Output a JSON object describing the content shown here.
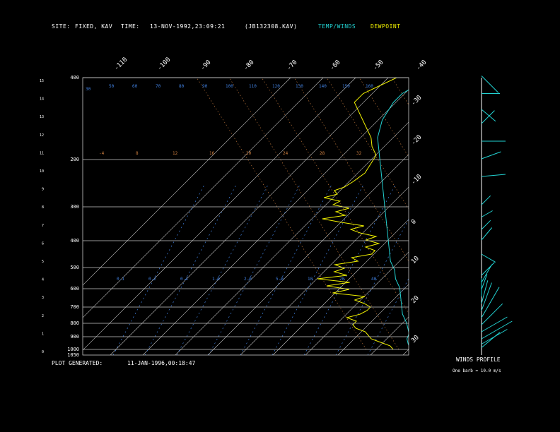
{
  "header": {
    "site_label": "SITE:",
    "site_value": "FIXED, KAV",
    "time_label": "TIME:",
    "time_value": "13-NOV-1992,23:09:21",
    "file": "(JB132308.KAV)",
    "legend_temp": "TEMP/WINDS",
    "legend_dew": "DEWPOINT"
  },
  "footer": {
    "generated_label": "PLOT GENERATED:",
    "generated_value": "11-JAN-1996,00:18:47",
    "winds_title": "WINDS PROFILE",
    "winds_note": "One barb = 10.0 m/s"
  },
  "colors": {
    "temperature": "#22d3d3",
    "dewpoint": "#f0f000",
    "isobar": "#c8c8c8",
    "isotherm": "#c8c8c8",
    "dry_adiabat": "#d08040",
    "mixing_ratio": "#4080e0",
    "moist_adiabat": "#d08040"
  },
  "chart_data": {
    "type": "line",
    "subtype": "skew-t log-p sounding",
    "pressure_ticks_mb": [
      "400",
      "200",
      "300",
      "400",
      "500",
      "600",
      "700",
      "800",
      "900",
      "1000",
      "1050"
    ],
    "isobars_mb": [
      400,
      200,
      300,
      400,
      500,
      600,
      700,
      800,
      900,
      1000
    ],
    "height_ticks_km": [
      "15",
      "14",
      "13",
      "12",
      "11",
      "10",
      "9",
      "8",
      "7",
      "6",
      "5",
      "4",
      "3",
      "2",
      "1",
      "0"
    ],
    "temp_top_ticks": [
      "-110",
      "-100",
      "-90",
      "-80",
      "-70",
      "-60",
      "-50",
      "-40"
    ],
    "temp_right_ticks": [
      "-30",
      "-20",
      "-10",
      "0",
      "10",
      "20",
      "30"
    ],
    "mixing_ratio_labels": [
      "0.1",
      "0.2",
      "0.4",
      "1.0",
      "2.0",
      "5.0",
      "10",
      "20",
      "40"
    ],
    "dry_adiabat_labels_row1": [
      "30",
      "50",
      "60",
      "70",
      "80",
      "90",
      "100",
      "110",
      "120",
      "130",
      "140",
      "150",
      "160"
    ],
    "dry_adiabat_labels_row2": [
      "-4",
      "8",
      "12",
      "16",
      "20",
      "24",
      "28",
      "32"
    ],
    "series": [
      {
        "name": "TEMP/WINDS",
        "points": [
          [
            0.0,
            -4.5
          ],
          [
            0.3,
            -7
          ],
          [
            0.6,
            -9
          ],
          [
            0.9,
            -10
          ],
          [
            1.2,
            -12
          ],
          [
            1.5,
            -14
          ],
          [
            2.0,
            -18
          ],
          [
            2.5,
            -21
          ],
          [
            3.0,
            -24
          ],
          [
            3.5,
            -27
          ],
          [
            4.0,
            -31
          ],
          [
            4.5,
            -34
          ],
          [
            5.0,
            -38
          ],
          [
            5.5,
            -41
          ],
          [
            6.0,
            -44
          ],
          [
            6.5,
            -47
          ],
          [
            7.0,
            -50
          ],
          [
            7.5,
            -53
          ],
          [
            8.0,
            -56
          ],
          [
            8.5,
            -59
          ],
          [
            9.0,
            -62
          ],
          [
            9.5,
            -65
          ],
          [
            10.0,
            -68
          ],
          [
            10.5,
            -71
          ],
          [
            11.0,
            -74
          ],
          [
            11.5,
            -77
          ],
          [
            12.0,
            -80
          ],
          [
            12.5,
            -82
          ],
          [
            13.0,
            -84
          ],
          [
            13.5,
            -85
          ],
          [
            14.0,
            -86
          ],
          [
            14.5,
            -86
          ],
          [
            15.0,
            -84
          ],
          [
            15.5,
            -83
          ]
        ]
      },
      {
        "name": "DEWPOINT",
        "points": [
          [
            0.0,
            -10
          ],
          [
            0.2,
            -12
          ],
          [
            0.4,
            -16
          ],
          [
            0.6,
            -20
          ],
          [
            0.8,
            -22
          ],
          [
            1.0,
            -24
          ],
          [
            1.2,
            -28
          ],
          [
            1.4,
            -30
          ],
          [
            1.6,
            -30
          ],
          [
            1.8,
            -34
          ],
          [
            2.0,
            -31
          ],
          [
            2.2,
            -30
          ],
          [
            2.4,
            -30
          ],
          [
            2.6,
            -33
          ],
          [
            2.8,
            -37
          ],
          [
            3.0,
            -35
          ],
          [
            3.2,
            -46
          ],
          [
            3.4,
            -42
          ],
          [
            3.6,
            -50
          ],
          [
            3.8,
            -44
          ],
          [
            4.0,
            -55
          ],
          [
            4.2,
            -47
          ],
          [
            4.4,
            -52
          ],
          [
            4.6,
            -50
          ],
          [
            4.8,
            -54
          ],
          [
            5.0,
            -48
          ],
          [
            5.2,
            -51
          ],
          [
            5.4,
            -46
          ],
          [
            5.6,
            -46
          ],
          [
            5.8,
            -50
          ],
          [
            6.0,
            -47
          ],
          [
            6.2,
            -52
          ],
          [
            6.4,
            -50
          ],
          [
            6.6,
            -56
          ],
          [
            6.8,
            -60
          ],
          [
            7.0,
            -57
          ],
          [
            7.2,
            -65
          ],
          [
            7.4,
            -72
          ],
          [
            7.6,
            -66
          ],
          [
            7.8,
            -70
          ],
          [
            8.0,
            -67
          ],
          [
            8.2,
            -73
          ],
          [
            8.4,
            -72
          ],
          [
            8.6,
            -78
          ],
          [
            8.8,
            -75
          ],
          [
            9.0,
            -77
          ],
          [
            9.2,
            -75
          ],
          [
            9.5,
            -74
          ],
          [
            10.0,
            -73
          ],
          [
            10.5,
            -74
          ],
          [
            11.0,
            -75
          ],
          [
            11.5,
            -79
          ],
          [
            12.0,
            -82
          ],
          [
            12.5,
            -86
          ],
          [
            13.0,
            -90
          ],
          [
            13.5,
            -94
          ],
          [
            14.0,
            -98
          ],
          [
            14.5,
            -98
          ],
          [
            15.0,
            -95
          ],
          [
            15.5,
            -92
          ]
        ]
      }
    ],
    "winds_profile": [
      [
        15.5,
        225,
        15
      ],
      [
        14.5,
        270,
        10
      ],
      [
        13.6,
        230,
        10
      ],
      [
        12.8,
        315,
        10
      ],
      [
        11.8,
        270,
        15
      ],
      [
        10.8,
        290,
        12
      ],
      [
        9.8,
        275,
        15
      ],
      [
        8.2,
        315,
        5
      ],
      [
        7.5,
        300,
        5
      ],
      [
        6.8,
        315,
        5
      ],
      [
        6.2,
        320,
        8
      ],
      [
        5.4,
        240,
        8
      ],
      [
        4.2,
        315,
        10
      ],
      [
        3.8,
        330,
        12
      ],
      [
        3.4,
        340,
        8
      ],
      [
        3.0,
        0,
        10
      ],
      [
        2.6,
        345,
        15
      ],
      [
        2.2,
        340,
        20
      ],
      [
        1.8,
        330,
        25
      ],
      [
        1.4,
        315,
        20
      ],
      [
        1.0,
        300,
        20
      ],
      [
        0.6,
        300,
        25
      ],
      [
        0.3,
        300,
        20
      ],
      [
        0.1,
        310,
        15
      ]
    ]
  }
}
